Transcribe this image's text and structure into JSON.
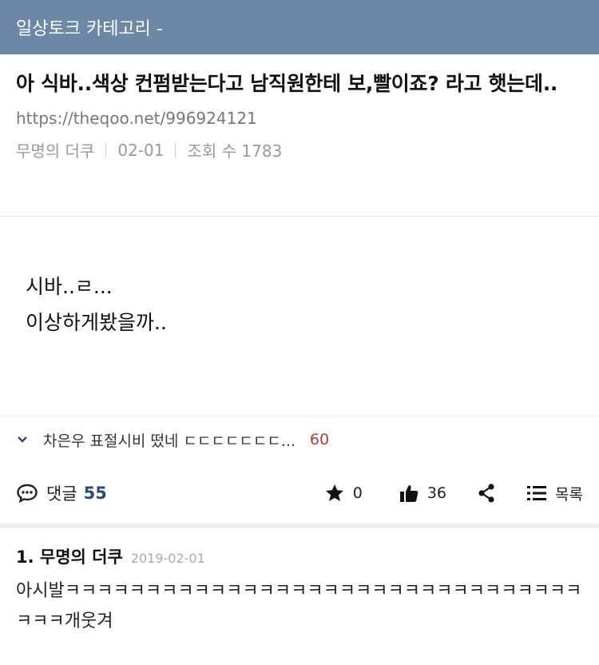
{
  "header": {
    "title": "일상토크 카테고리 -"
  },
  "post": {
    "title": "아 식바..색상 컨펌받는다고 남직원한테 보,빨이죠? 라고 햇는데..",
    "url": "https://theqoo.net/996924121",
    "author": "무명의 더쿠",
    "date": "02-01",
    "views_label": "조회 수 1783",
    "content_lines": [
      "시바..ㄹ...",
      "이상하게봤을까.."
    ]
  },
  "related": {
    "text": "차은우 표절시비 떴네 ㄷㄷㄷㄷㄷㄷㄷ...",
    "count": "60",
    "icon": "chevron-down-icon"
  },
  "actions": {
    "comment_label": "댓글",
    "comment_count": "55",
    "star_count": "0",
    "like_count": "36",
    "list_label": "목록"
  },
  "comments": [
    {
      "author": "1. 무명의 더쿠",
      "date": "2019-02-01",
      "body": "아시발ㅋㅋㅋㅋㅋㅋㅋㅋㅋㅋㅋㅋㅋㅋㅋㅋㅋㅋㅋㅋㅋㅋㅋㅋㅋㅋㅋㅋㅋㅋㅋㅋㅋㅋㅋ개웃겨"
    }
  ],
  "colors": {
    "header_bg": "#6d87a6",
    "accent_count": "#2b4a75",
    "related_count": "#b23a3a"
  }
}
